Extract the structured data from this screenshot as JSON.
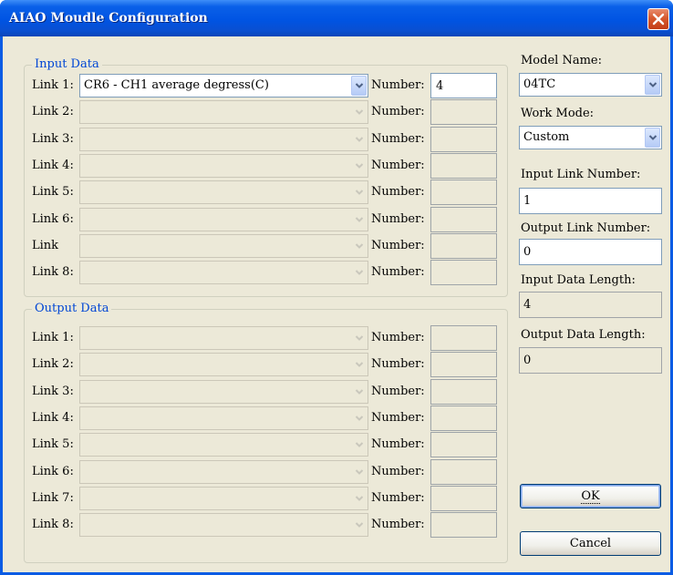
{
  "window": {
    "title": "AIAO Moudle Configuration"
  },
  "input_data": {
    "group_label": "Input Data",
    "number_label": "Number:",
    "rows": [
      {
        "label": "Link 1:",
        "value": "CR6 - CH1 average degress(C)",
        "number": "4"
      },
      {
        "label": "Link 2:",
        "value": "",
        "number": ""
      },
      {
        "label": "Link 3:",
        "value": "",
        "number": ""
      },
      {
        "label": "Link 4:",
        "value": "",
        "number": ""
      },
      {
        "label": "Link 5:",
        "value": "",
        "number": ""
      },
      {
        "label": "Link 6:",
        "value": "",
        "number": ""
      },
      {
        "label": "Link",
        "value": "",
        "number": ""
      },
      {
        "label": "Link 8:",
        "value": "",
        "number": ""
      }
    ]
  },
  "output_data": {
    "group_label": "Output Data",
    "number_label": "Number:",
    "rows": [
      {
        "label": "Link 1:",
        "value": "",
        "number": ""
      },
      {
        "label": "Link 2:",
        "value": "",
        "number": ""
      },
      {
        "label": "Link 3:",
        "value": "",
        "number": ""
      },
      {
        "label": "Link 4:",
        "value": "",
        "number": ""
      },
      {
        "label": "Link 5:",
        "value": "",
        "number": ""
      },
      {
        "label": "Link 6:",
        "value": "",
        "number": ""
      },
      {
        "label": "Link 7:",
        "value": "",
        "number": ""
      },
      {
        "label": "Link 8:",
        "value": "",
        "number": ""
      }
    ]
  },
  "settings": {
    "model_name_label": "Model Name:",
    "model_name": "04TC",
    "work_mode_label": "Work Mode:",
    "work_mode": "Custom",
    "input_link_number_label": "Input Link Number:",
    "input_link_number": "1",
    "output_link_number_label": "Output Link Number:",
    "output_link_number": "0",
    "input_data_length_label": "Input Data Length:",
    "input_data_length": "4",
    "output_data_length_label": "Output Data Length:",
    "output_data_length": "0"
  },
  "buttons": {
    "ok": "OK",
    "cancel": "Cancel"
  },
  "icons": {
    "close": "close-icon",
    "dropdown": "chevron-down-icon"
  },
  "colors": {
    "title_bar": "#0054e3",
    "group_title": "#0046d5",
    "dialog_bg": "#ece9d8"
  }
}
